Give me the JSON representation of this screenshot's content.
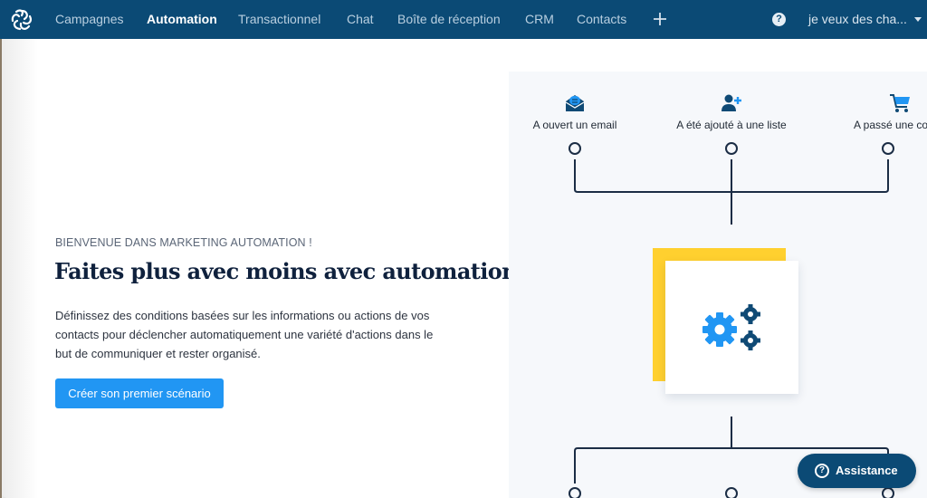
{
  "topbar": {
    "logo": "sendinblue-logo-icon",
    "nav": [
      {
        "label": "Campagnes",
        "active": false
      },
      {
        "label": "Automation",
        "active": true
      },
      {
        "label": "Transactionnel",
        "active": false
      },
      {
        "label": "Chat",
        "active": false
      },
      {
        "label": "Boîte de réception",
        "active": false
      },
      {
        "label": "CRM",
        "active": false
      },
      {
        "label": "Contacts",
        "active": false
      }
    ],
    "add_icon": "plus-icon",
    "help_glyph": "?",
    "account_label": "je veux des cha...",
    "colors": {
      "background": "#0b4a75",
      "active_text": "#ffffff",
      "inactive_text": "#b9cfe0"
    }
  },
  "hero": {
    "eyebrow": "BIENVENUE DANS MARKETING AUTOMATION !",
    "title": "Faites plus avec moins avec automation",
    "description": "Définissez des conditions basées sur les informations ou actions de vos contacts pour déclencher automatiquement une variété d'actions dans le but de communiquer et rester organisé.",
    "cta_label": "Créer son premier scénario",
    "cta_color": "#2196f3"
  },
  "illustration": {
    "triggers": [
      {
        "label": "A ouvert un email",
        "icon": "open-envelope-icon"
      },
      {
        "label": "A été ajouté à une liste",
        "icon": "add-user-icon"
      },
      {
        "label": "A passé une comm",
        "icon": "shopping-cart-icon"
      }
    ],
    "center_icon": "gears-icon",
    "colors": {
      "accent_yellow": "#ffd02f",
      "gear_blue": "#2196f3",
      "navy": "#0f3a5f",
      "line": "#1b2d45"
    }
  },
  "assistance": {
    "label": "Assistance",
    "icon_glyph": "?"
  }
}
